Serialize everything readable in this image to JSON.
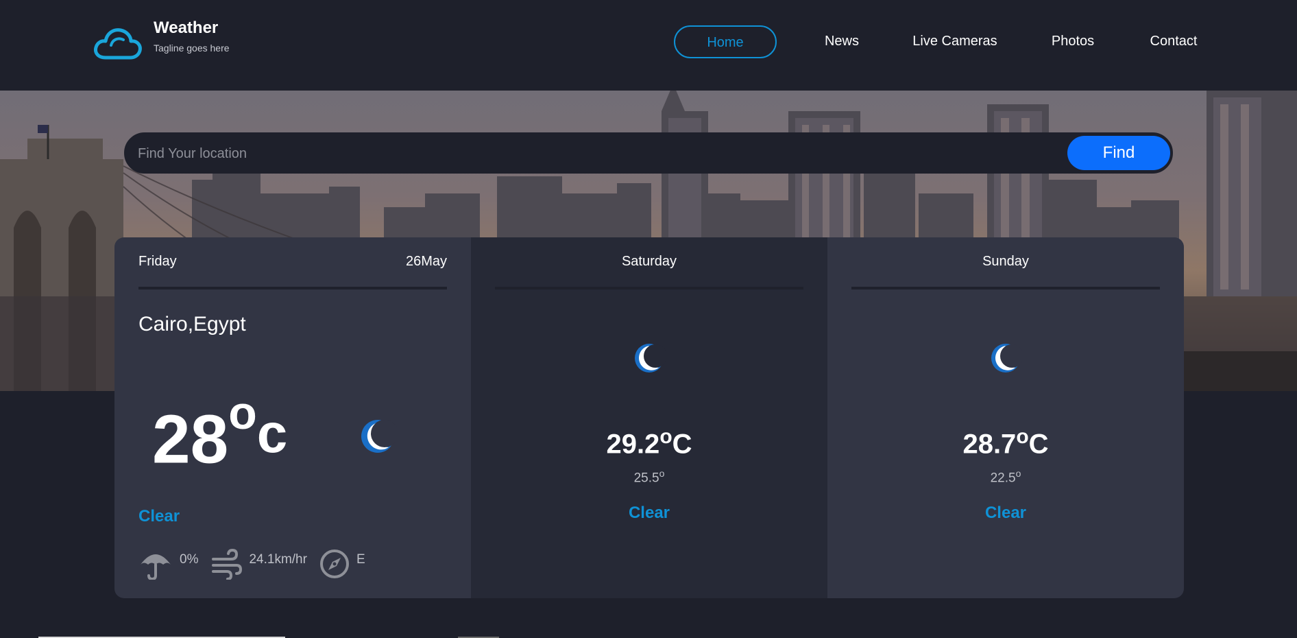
{
  "brand": {
    "title": "Weather",
    "tagline": "Tagline goes here",
    "logo_icon": "cloud-icon",
    "accent": "#0f92d6"
  },
  "nav": {
    "items": [
      {
        "label": "Home",
        "active": true
      },
      {
        "label": "News",
        "active": false
      },
      {
        "label": "Live Cameras",
        "active": false
      },
      {
        "label": "Photos",
        "active": false
      },
      {
        "label": "Contact",
        "active": false
      }
    ]
  },
  "search": {
    "placeholder": "Find Your location",
    "value": "",
    "button_label": "Find",
    "button_color": "#0c6efc"
  },
  "forecast": {
    "today": {
      "day": "Friday",
      "date": "26May",
      "location": "Cairo,Egypt",
      "temp": "28",
      "temp_unit": "oc",
      "icon": "moon-icon",
      "condition": "Clear",
      "rain": "0%",
      "wind": "24.1km/hr",
      "direction": "E"
    },
    "days": [
      {
        "day": "Saturday",
        "icon": "moon-icon",
        "max": "29.2",
        "max_unit": "oC",
        "min": "25.5",
        "min_unit": "o",
        "condition": "Clear"
      },
      {
        "day": "Sunday",
        "icon": "moon-icon",
        "max": "28.7",
        "max_unit": "oC",
        "min": "22.5",
        "min_unit": "o",
        "condition": "Clear"
      }
    ]
  }
}
